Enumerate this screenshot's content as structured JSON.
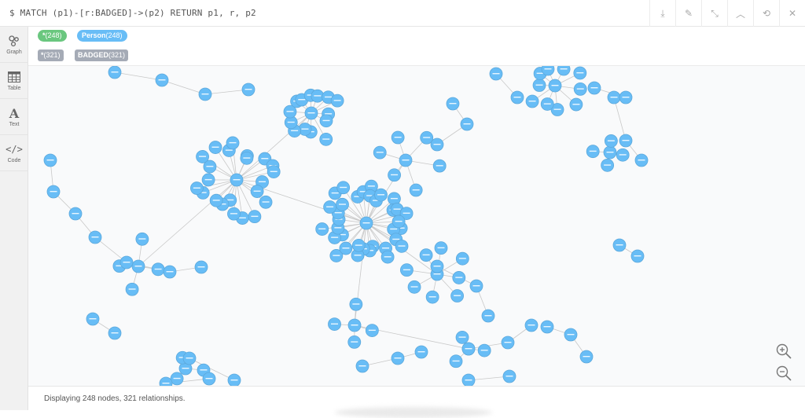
{
  "editor": {
    "query": "$ MATCH (p1)-[r:BADGED]->(p2) RETURN p1, r, p2"
  },
  "toolbar": {
    "buttons": [
      {
        "name": "download-icon",
        "glyph": "⤓"
      },
      {
        "name": "pin-icon",
        "glyph": "✎"
      },
      {
        "name": "collapse-icon",
        "glyph": "⤡"
      },
      {
        "name": "chevron-up-icon",
        "glyph": "︿"
      },
      {
        "name": "refresh-icon",
        "glyph": "⟲"
      },
      {
        "name": "close-icon",
        "glyph": "✕"
      }
    ]
  },
  "sidebar": {
    "items": [
      {
        "id": "graph",
        "label": "Graph",
        "active": true
      },
      {
        "id": "table",
        "label": "Table",
        "active": false
      },
      {
        "id": "text",
        "label": "Text",
        "active": false
      },
      {
        "id": "code",
        "label": "Code",
        "active": false
      }
    ]
  },
  "legend": {
    "labels": [
      {
        "text": "*",
        "count": "(248)",
        "color": "#6ac77f"
      },
      {
        "text": "Person",
        "count": "(248)",
        "color": "#68bdf6"
      }
    ],
    "rels": [
      {
        "text": "*",
        "count": "(321)",
        "color": "#a5abb6"
      },
      {
        "text": "BADGED",
        "count": "(321)",
        "color": "#a5abb6"
      }
    ]
  },
  "graph": {
    "node_color": "#68bdf6",
    "edge_color": "#c8c8c8",
    "node_count": 248,
    "relationship_count": 321
  },
  "footer": {
    "status": "Displaying 248 nodes, 321 relationships."
  }
}
